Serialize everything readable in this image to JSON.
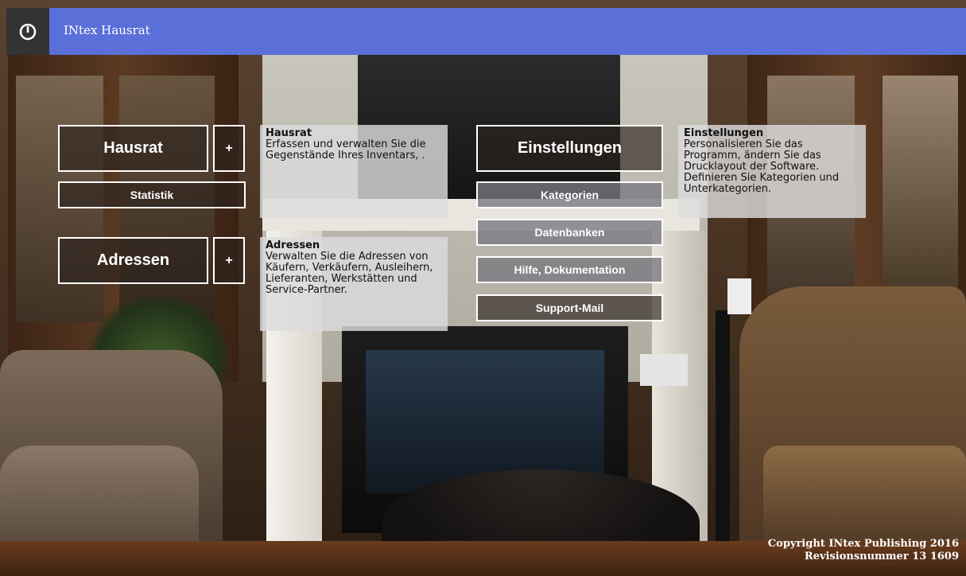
{
  "header": {
    "title": "INtex Hausrat",
    "power_icon": "power-icon"
  },
  "left_menu": {
    "hausrat_label": "Hausrat",
    "hausrat_add_label": "+",
    "statistik_label": "Statistik",
    "adressen_label": "Adressen",
    "adressen_add_label": "+"
  },
  "info_hausrat": {
    "title": "Hausrat",
    "text": "Erfassen und verwalten Sie die Gegenstände Ihres Inventars, ."
  },
  "info_adressen": {
    "title": "Adressen",
    "text": "Verwalten Sie die Adressen von Käufern, Verkäufern, Ausleihern, Lieferanten, Werkstätten und Service-Partner."
  },
  "right_menu": {
    "einstellungen_label": "Einstellungen",
    "kategorien_label": "Kategorien",
    "datenbanken_label": "Datenbanken",
    "hilfe_label": "Hilfe, Dokumentation",
    "support_label": "Support-Mail"
  },
  "info_einstellungen": {
    "title": "Einstellungen",
    "text": "Personalisieren Sie das Programm, ändern Sie das Drucklayout der Software. Definieren Sie Kategorien und Unterkategorien."
  },
  "footer": {
    "copyright": "Copyright INtex Publishing 2016",
    "revision": "Revisionsnummer 13 1609"
  },
  "colors": {
    "header_bg": "#5a6fd8",
    "power_bg": "#333333",
    "tile_border": "#ffffff"
  }
}
